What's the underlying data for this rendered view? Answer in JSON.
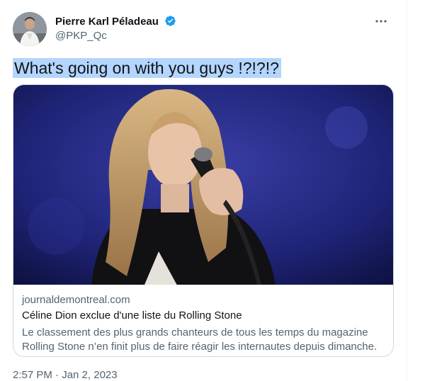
{
  "author": {
    "name": "Pierre Karl Péladeau",
    "handle": "@PKP_Qc",
    "verified": true,
    "verified_color": "#1d9bf0"
  },
  "tweet": {
    "text": "What's going on with you guys !?!?!?",
    "selection_color": "#b4d5fe"
  },
  "card": {
    "domain": "journaldemontreal.com",
    "title": "Céline Dion exclue d'une liste du Rolling Stone",
    "description": "Le classement des plus grands chanteurs de tous les temps du magazine Rolling Stone n’en finit plus de faire réagir les internautes depuis dimanche."
  },
  "timestamp": "2:57 PM · Jan 2, 2023",
  "icons": {
    "more": "more-dots-icon",
    "verified": "verified-badge-icon"
  }
}
